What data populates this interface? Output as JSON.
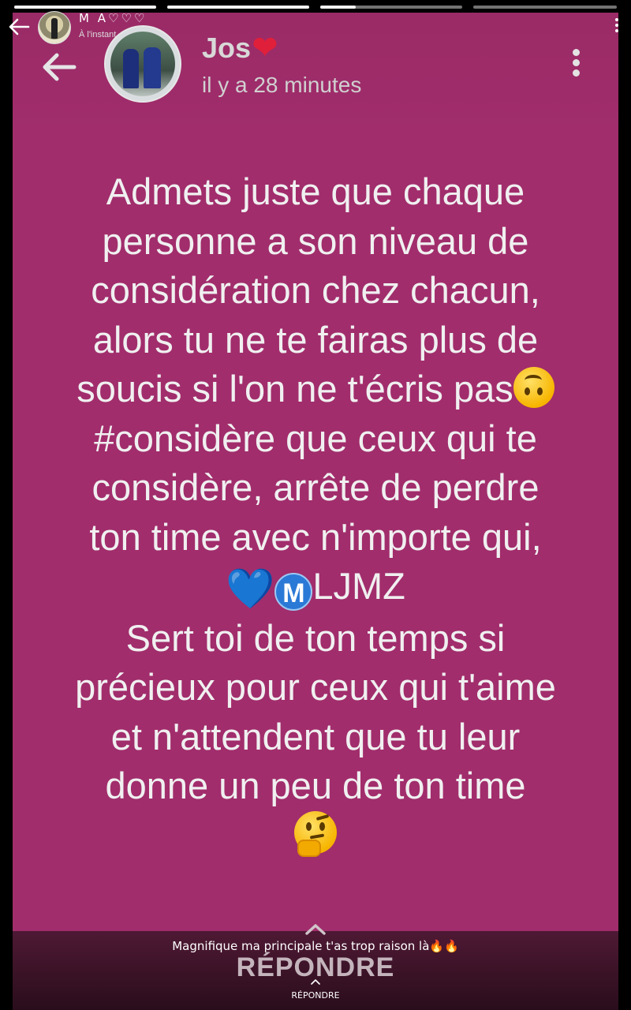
{
  "outer": {
    "user_name": "M A♡♡♡",
    "timestamp": "À l'instant"
  },
  "story": {
    "author_name": "Jos",
    "author_heart": "❤",
    "timestamp": "il y a 28 minutes",
    "background_color": "#a12d6c",
    "text_lines": [
      "Admets juste que chaque",
      "personne a son niveau de",
      "considération chez chacun,",
      "alors tu ne te fairas plus de",
      "soucis si l'on ne t'écris pas",
      "#considère que ceux qui te",
      "considère, arrête de perdre",
      "ton time avec n'importe qui,",
      "LJMZ",
      "Sert toi de ton temps si",
      "précieux pour ceux qui t'aime",
      "et n'attendent que tu leur",
      "donne un peu de ton time"
    ],
    "badge_letter": "M",
    "blue_heart": "💙",
    "icons": {
      "upside_down_face": "upside-down-face-emoji",
      "thinking_face": "thinking-face-emoji"
    },
    "reply_label": "RÉPONDRE"
  },
  "comment": {
    "text": "Magnifique ma principale t'as trop raison là",
    "emojis": "🔥🔥"
  },
  "reply_label": "RÉPONDRE"
}
